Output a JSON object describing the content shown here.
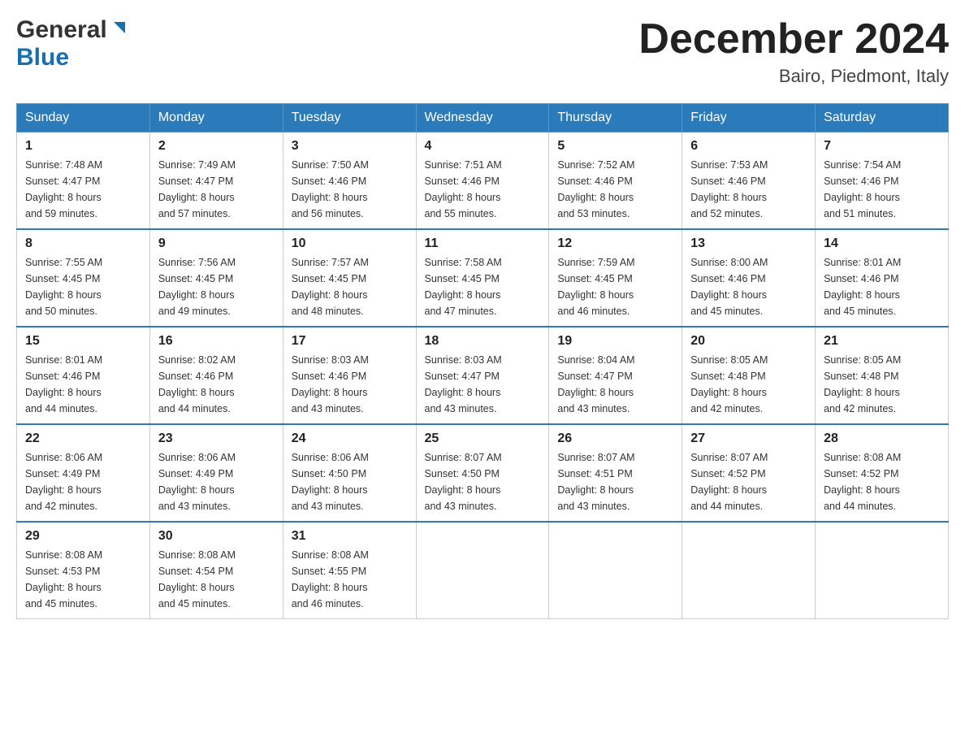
{
  "header": {
    "logo_general": "General",
    "logo_blue": "Blue",
    "month_title": "December 2024",
    "location": "Bairo, Piedmont, Italy"
  },
  "weekdays": [
    "Sunday",
    "Monday",
    "Tuesday",
    "Wednesday",
    "Thursday",
    "Friday",
    "Saturday"
  ],
  "weeks": [
    [
      {
        "day": "1",
        "sunrise": "7:48 AM",
        "sunset": "4:47 PM",
        "daylight": "8 hours and 59 minutes."
      },
      {
        "day": "2",
        "sunrise": "7:49 AM",
        "sunset": "4:47 PM",
        "daylight": "8 hours and 57 minutes."
      },
      {
        "day": "3",
        "sunrise": "7:50 AM",
        "sunset": "4:46 PM",
        "daylight": "8 hours and 56 minutes."
      },
      {
        "day": "4",
        "sunrise": "7:51 AM",
        "sunset": "4:46 PM",
        "daylight": "8 hours and 55 minutes."
      },
      {
        "day": "5",
        "sunrise": "7:52 AM",
        "sunset": "4:46 PM",
        "daylight": "8 hours and 53 minutes."
      },
      {
        "day": "6",
        "sunrise": "7:53 AM",
        "sunset": "4:46 PM",
        "daylight": "8 hours and 52 minutes."
      },
      {
        "day": "7",
        "sunrise": "7:54 AM",
        "sunset": "4:46 PM",
        "daylight": "8 hours and 51 minutes."
      }
    ],
    [
      {
        "day": "8",
        "sunrise": "7:55 AM",
        "sunset": "4:45 PM",
        "daylight": "8 hours and 50 minutes."
      },
      {
        "day": "9",
        "sunrise": "7:56 AM",
        "sunset": "4:45 PM",
        "daylight": "8 hours and 49 minutes."
      },
      {
        "day": "10",
        "sunrise": "7:57 AM",
        "sunset": "4:45 PM",
        "daylight": "8 hours and 48 minutes."
      },
      {
        "day": "11",
        "sunrise": "7:58 AM",
        "sunset": "4:45 PM",
        "daylight": "8 hours and 47 minutes."
      },
      {
        "day": "12",
        "sunrise": "7:59 AM",
        "sunset": "4:45 PM",
        "daylight": "8 hours and 46 minutes."
      },
      {
        "day": "13",
        "sunrise": "8:00 AM",
        "sunset": "4:46 PM",
        "daylight": "8 hours and 45 minutes."
      },
      {
        "day": "14",
        "sunrise": "8:01 AM",
        "sunset": "4:46 PM",
        "daylight": "8 hours and 45 minutes."
      }
    ],
    [
      {
        "day": "15",
        "sunrise": "8:01 AM",
        "sunset": "4:46 PM",
        "daylight": "8 hours and 44 minutes."
      },
      {
        "day": "16",
        "sunrise": "8:02 AM",
        "sunset": "4:46 PM",
        "daylight": "8 hours and 44 minutes."
      },
      {
        "day": "17",
        "sunrise": "8:03 AM",
        "sunset": "4:46 PM",
        "daylight": "8 hours and 43 minutes."
      },
      {
        "day": "18",
        "sunrise": "8:03 AM",
        "sunset": "4:47 PM",
        "daylight": "8 hours and 43 minutes."
      },
      {
        "day": "19",
        "sunrise": "8:04 AM",
        "sunset": "4:47 PM",
        "daylight": "8 hours and 43 minutes."
      },
      {
        "day": "20",
        "sunrise": "8:05 AM",
        "sunset": "4:48 PM",
        "daylight": "8 hours and 42 minutes."
      },
      {
        "day": "21",
        "sunrise": "8:05 AM",
        "sunset": "4:48 PM",
        "daylight": "8 hours and 42 minutes."
      }
    ],
    [
      {
        "day": "22",
        "sunrise": "8:06 AM",
        "sunset": "4:49 PM",
        "daylight": "8 hours and 42 minutes."
      },
      {
        "day": "23",
        "sunrise": "8:06 AM",
        "sunset": "4:49 PM",
        "daylight": "8 hours and 43 minutes."
      },
      {
        "day": "24",
        "sunrise": "8:06 AM",
        "sunset": "4:50 PM",
        "daylight": "8 hours and 43 minutes."
      },
      {
        "day": "25",
        "sunrise": "8:07 AM",
        "sunset": "4:50 PM",
        "daylight": "8 hours and 43 minutes."
      },
      {
        "day": "26",
        "sunrise": "8:07 AM",
        "sunset": "4:51 PM",
        "daylight": "8 hours and 43 minutes."
      },
      {
        "day": "27",
        "sunrise": "8:07 AM",
        "sunset": "4:52 PM",
        "daylight": "8 hours and 44 minutes."
      },
      {
        "day": "28",
        "sunrise": "8:08 AM",
        "sunset": "4:52 PM",
        "daylight": "8 hours and 44 minutes."
      }
    ],
    [
      {
        "day": "29",
        "sunrise": "8:08 AM",
        "sunset": "4:53 PM",
        "daylight": "8 hours and 45 minutes."
      },
      {
        "day": "30",
        "sunrise": "8:08 AM",
        "sunset": "4:54 PM",
        "daylight": "8 hours and 45 minutes."
      },
      {
        "day": "31",
        "sunrise": "8:08 AM",
        "sunset": "4:55 PM",
        "daylight": "8 hours and 46 minutes."
      },
      null,
      null,
      null,
      null
    ]
  ],
  "labels": {
    "sunrise": "Sunrise:",
    "sunset": "Sunset:",
    "daylight": "Daylight:"
  }
}
